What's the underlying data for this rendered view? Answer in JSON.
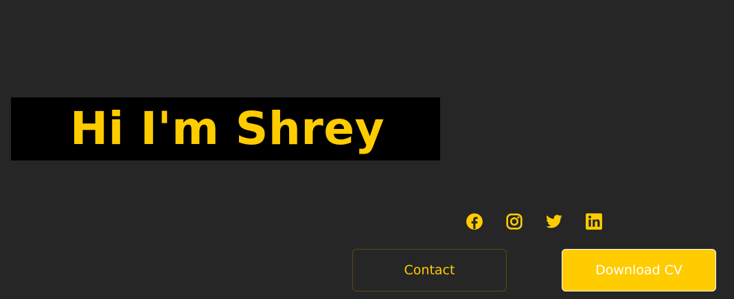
{
  "hero": {
    "title": "Hi I'm Shrey"
  },
  "social": [
    {
      "icon": "facebook-icon"
    },
    {
      "icon": "instagram-icon"
    },
    {
      "icon": "twitter-icon"
    },
    {
      "icon": "linkedin-icon"
    }
  ],
  "buttons": {
    "contact_label": "Contact",
    "download_label": "Download CV"
  },
  "colors": {
    "background": "#262626",
    "accent": "#FFCC00",
    "title_box": "#000000"
  }
}
